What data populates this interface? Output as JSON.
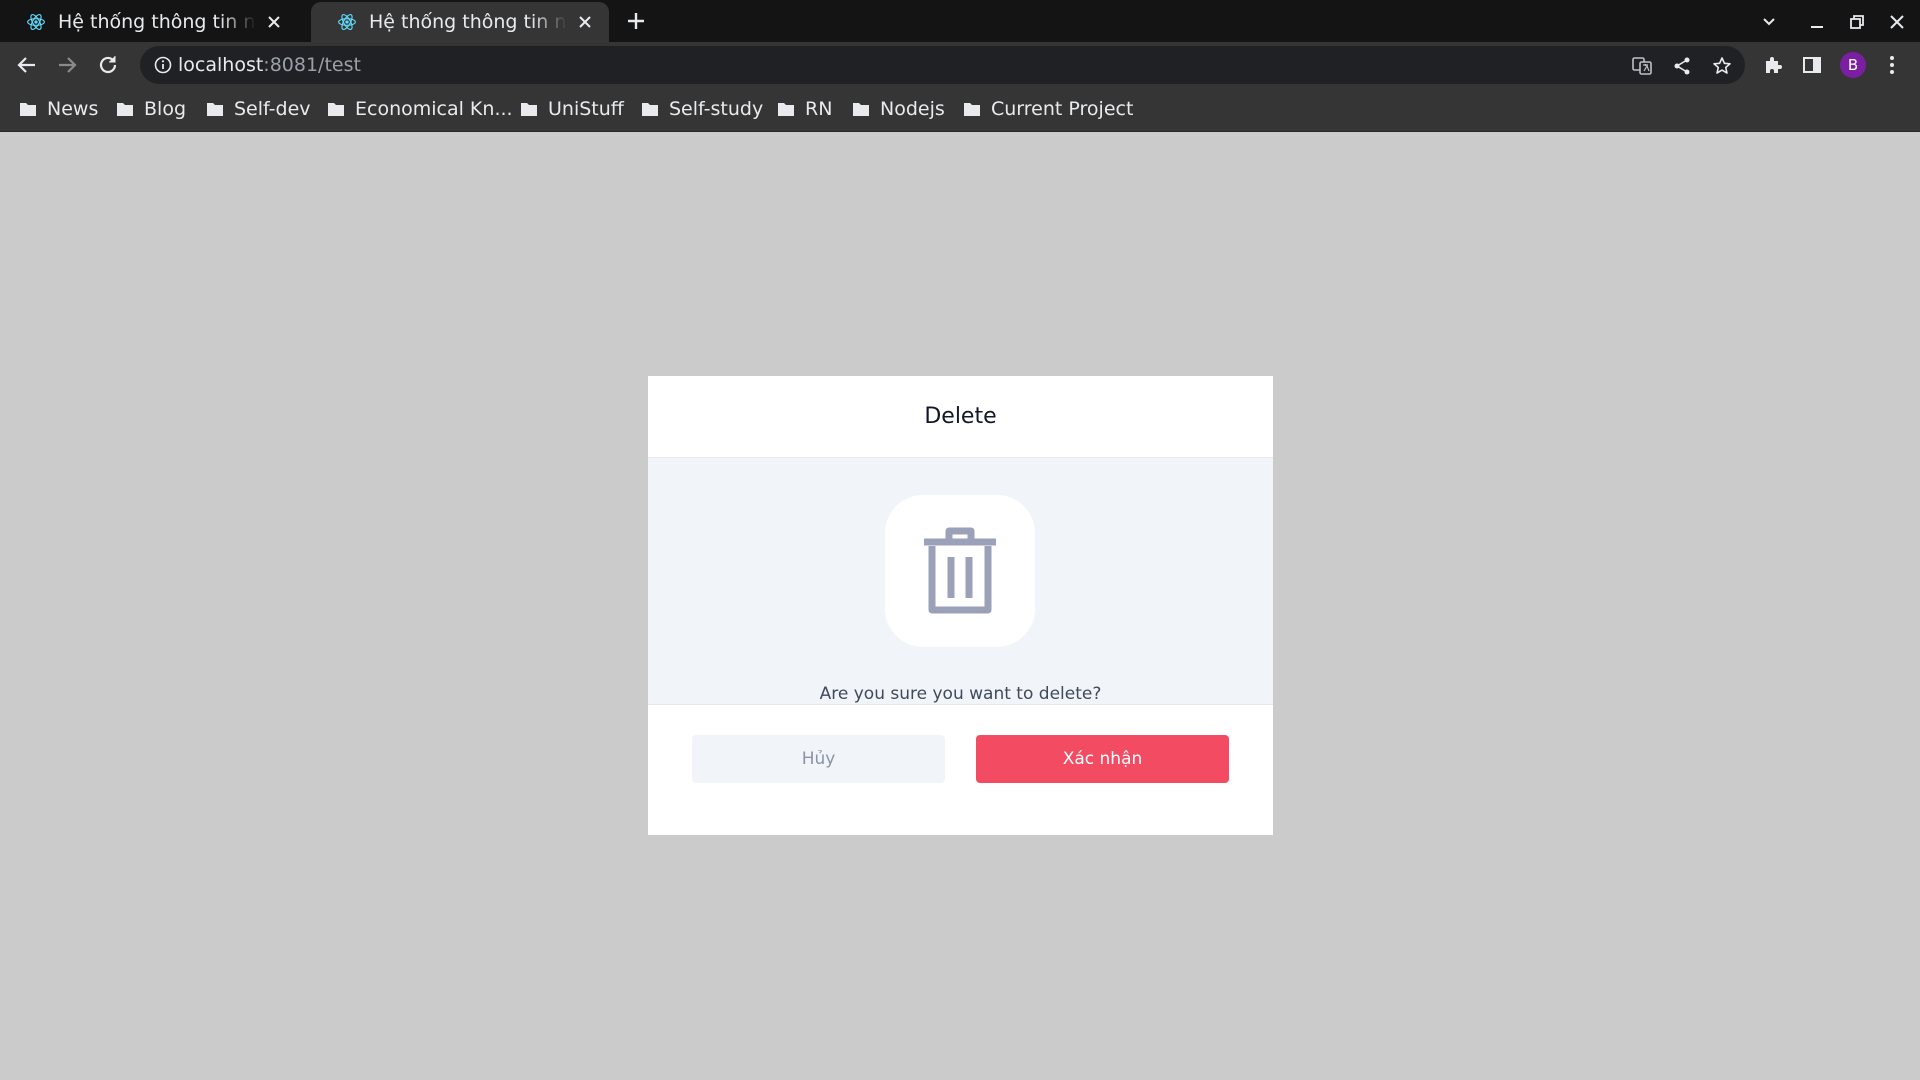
{
  "browser": {
    "tabs": [
      {
        "title": "Hệ thống thông tin nguồn",
        "active": false
      },
      {
        "title": "Hệ thống thông tin nguồn",
        "active": true
      }
    ],
    "address": {
      "host": "localhost",
      "path": ":8081/test"
    },
    "profile_initial": "B",
    "bookmarks": [
      "News",
      "Blog",
      "Self-dev",
      "Economical Kn...",
      "UniStuff",
      "Self-study",
      "RN",
      "Nodejs",
      "Current Project"
    ]
  },
  "dialog": {
    "title": "Delete",
    "icon": "trash-icon",
    "message": "Are you sure you want to delete?",
    "cancel_label": "Hủy",
    "confirm_label": "Xác nhận"
  },
  "colors": {
    "overlay": "#cbcbcb",
    "confirm": "#f24b62",
    "icon": "#9ba1b9",
    "panel": "#f1f4f8",
    "avatar": "#7b1fa2"
  }
}
